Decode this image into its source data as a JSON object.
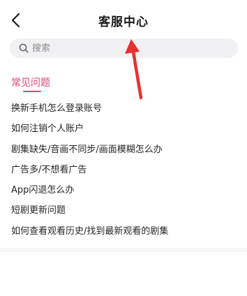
{
  "header": {
    "title": "客服中心",
    "back_icon": "chevron-left-icon"
  },
  "search": {
    "placeholder": "搜索",
    "value": "",
    "icon": "search-icon"
  },
  "faq": {
    "section_title": "常见问题",
    "accent_color": "#e0456f",
    "items": [
      "换新手机怎么登录账号",
      "如何注销个人账户",
      "剧集缺失/音画不同步/画面模糊怎么办",
      "广告多/不想看广告",
      "App闪退怎么办",
      "短剧更新问题",
      "如何查看观看历史/找到最新观看的剧集"
    ]
  },
  "annotation": {
    "arrow_color": "#e8302f"
  }
}
